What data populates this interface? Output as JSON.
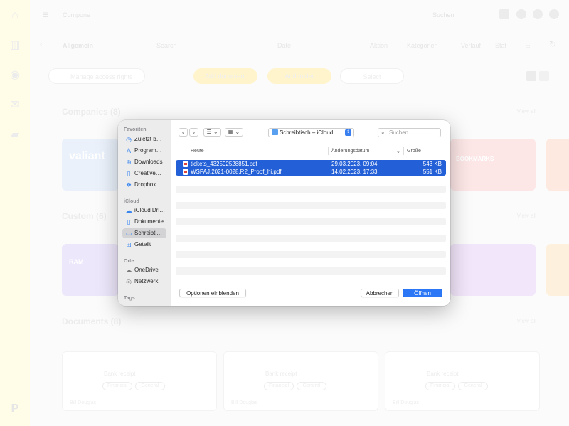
{
  "app": {
    "title": "Compone",
    "search_placeholder": "Suchen",
    "user_name": "Allgemein",
    "toolbar": {
      "search": "Search",
      "date": "Date",
      "filters": [
        "Aktion",
        "Kategorien",
        "Verlauf",
        "Stat"
      ]
    },
    "manage_label": "Manage access rights",
    "buttons": [
      "Add document",
      "Add folder",
      "Select"
    ],
    "sections": [
      {
        "title": "Companies (8)",
        "link": "View all"
      },
      {
        "title": "Custom (6)",
        "link": "View all"
      },
      {
        "title": "Documents (8)",
        "link": "View all"
      }
    ],
    "cards": {
      "logo_text": "valiant",
      "ram_label": "RAM",
      "extra_label": "BOOKMARKS"
    },
    "documents": [
      {
        "title": "Bank receipt",
        "tags": [
          "Financial",
          "General"
        ],
        "footer": "Bill Douglas"
      },
      {
        "title": "Bank receipt",
        "tags": [
          "Financial",
          "General"
        ],
        "footer": "Bill Douglas"
      },
      {
        "title": "Bank receipt",
        "tags": [
          "Financial",
          "General"
        ],
        "footer": "Bill Douglas"
      }
    ]
  },
  "dialog": {
    "sidebar": {
      "favorites_header": "Favoriten",
      "favorites": [
        "Zuletzt b…",
        "Program…",
        "Downloads",
        "Creative…",
        "Dropbox…"
      ],
      "icloud_header": "iCloud",
      "icloud": [
        "iCloud Dri…",
        "Dokumente",
        "Schreibti…",
        "Geteilt"
      ],
      "places_header": "Orte",
      "places": [
        "OneDrive",
        "Netzwerk"
      ],
      "tags_header": "Tags"
    },
    "location": "Schreibtisch – iCloud",
    "search_placeholder": "Suchen",
    "columns": {
      "name": "Heute",
      "date": "Änderungsdatum",
      "size": "Größe"
    },
    "files": [
      {
        "name": "tickets_432592528851.pdf",
        "date": "29.03.2023, 09:04",
        "size": "543 KB"
      },
      {
        "name": "WSPAJ.2021-0028.R2_Proof_hi.pdf",
        "date": "14.02.2023, 17:33",
        "size": "551 KB"
      }
    ],
    "options_label": "Optionen einblenden",
    "cancel_label": "Abbrechen",
    "open_label": "Öffnen"
  },
  "colors": {
    "selection": "#2360d8",
    "primary_button": "#2b77f5",
    "sidebar_bg": "#ececec",
    "app_sidebar_bg": "#fffde7"
  }
}
